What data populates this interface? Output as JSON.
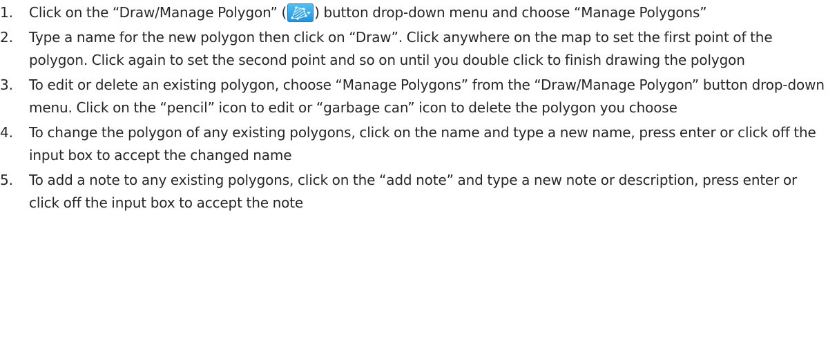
{
  "steps": [
    {
      "num": "1.",
      "before": "Click on the “Draw/Manage Polygon” (",
      "icon": "draw-polygon-icon",
      "after": ") button drop-down menu and choose “Manage Polygons”"
    },
    {
      "num": "2.",
      "text": "Type a name for the new polygon then click on “Draw”. Click anywhere on the map to set the first point of the polygon. Click again to set the second point and so on until you double click to finish drawing the polygon"
    },
    {
      "num": "3.",
      "text": "To edit or delete an existing polygon, choose “Manage Polygons” from the “Draw/Manage Polygon” button drop-down menu.  Click on the “pencil” icon to edit or “garbage can” icon to delete the polygon you choose"
    },
    {
      "num": "4.",
      "text": "To change the polygon of any existing polygons, click on the name and type a new name, press enter or click off the input box to accept the changed name"
    },
    {
      "num": "5.",
      "text": "To add a note to any existing polygons, click on the “add note” and type a new note or description, press enter or click off the input box to accept the note"
    }
  ]
}
